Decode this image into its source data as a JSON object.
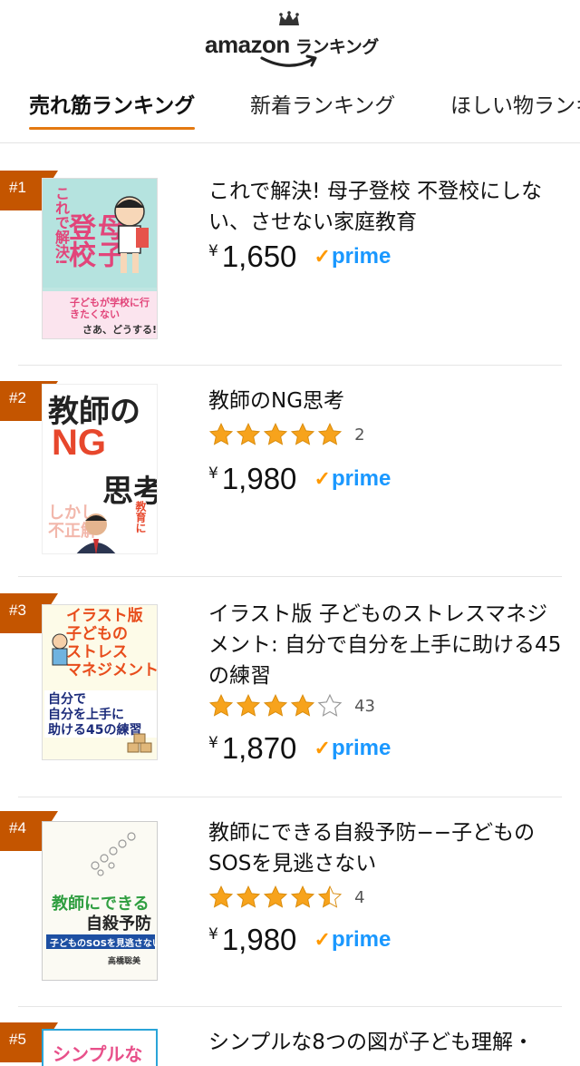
{
  "header": {
    "logo_word": "amazon",
    "logo_sub": "ランキング"
  },
  "tabs": [
    {
      "label": "売れ筋ランキング",
      "active": true
    },
    {
      "label": "新着ランキング",
      "active": false
    },
    {
      "label": "ほしい物ランキング",
      "active": false
    }
  ],
  "items": [
    {
      "rank": "#1",
      "title": "これで解決! 母子登校 不登校にしない、させない家庭教育",
      "price": "1,650",
      "prime": "prime",
      "rating": null,
      "reviews": null,
      "cover_title": "これで解決!母子登校",
      "cover_sub": "子どもが学校に行きたくないと言いだした! さあ、どうする!?"
    },
    {
      "rank": "#2",
      "title": "教師のNG思考",
      "price": "1,980",
      "prime": "prime",
      "rating": 5,
      "reviews": "2",
      "cover_title": "教師のNG思考",
      "cover_sub": "教育に絶対的な正解はない しかし不正解はある"
    },
    {
      "rank": "#3",
      "title": "イラスト版 子どものストレスマネジメント: 自分で自分を上手に助ける45の練習",
      "price": "1,870",
      "prime": "prime",
      "rating": 4,
      "reviews": "43",
      "cover_title": "イラスト版 子どものストレスマネジメント",
      "cover_sub": "自分で自分を上手に助ける45の練習"
    },
    {
      "rank": "#4",
      "title": "教師にできる自殺予防−−子どものSOSを見逃さない",
      "price": "1,980",
      "prime": "prime",
      "rating": 4.5,
      "reviews": "4",
      "cover_title": "教師にできる自殺予防",
      "cover_sub": "子どものSOSを見逃さない"
    },
    {
      "rank": "#5",
      "title": "シンプルな8つの図が子ども理解・",
      "price": "",
      "prime": "",
      "rating": null,
      "reviews": null,
      "cover_title": "シンプルな",
      "cover_sub": ""
    }
  ],
  "colors": {
    "rank_badge": "#c45500",
    "tab_underline": "#e47911",
    "prime_blue": "#1a98ff",
    "prime_check": "#ff9900",
    "star": "#f7a31c"
  }
}
